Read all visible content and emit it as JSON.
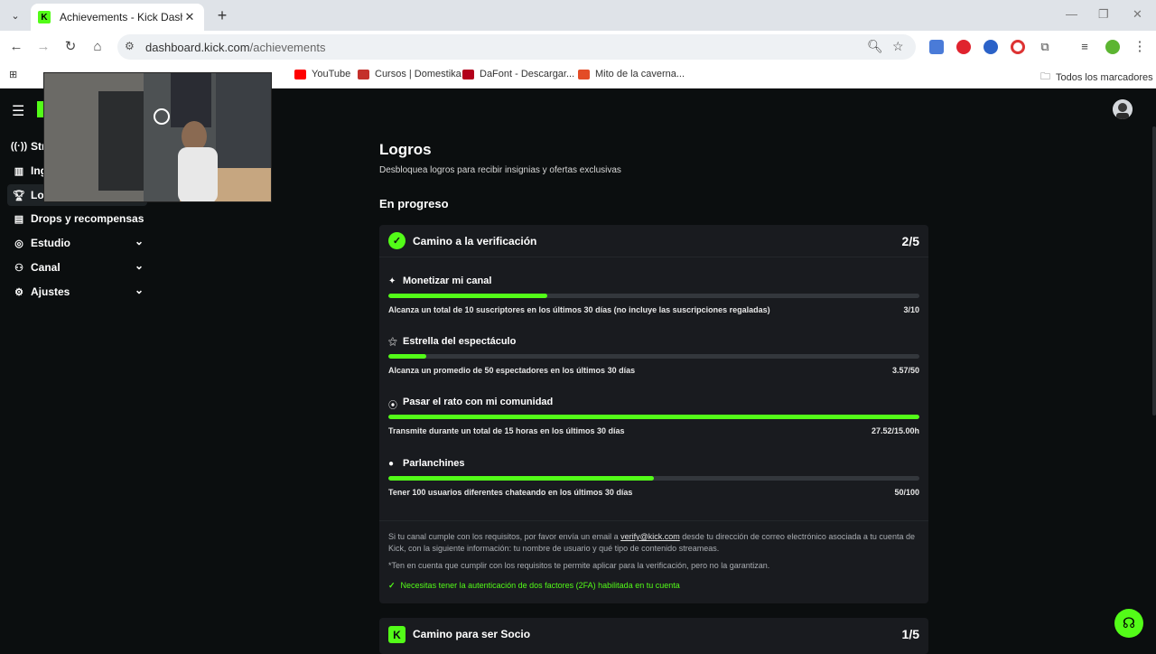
{
  "browser": {
    "tab_title": "Achievements - Kick Dashboard",
    "url_domain": "dashboard.kick.com",
    "url_path": "/achievements",
    "bookmarks": [
      {
        "label": "YouTube",
        "color": "#ff0000"
      },
      {
        "label": "Cursos | Domestika",
        "color": "#c4302b"
      },
      {
        "label": "DaFont - Descargar...",
        "color": "#b3001b"
      },
      {
        "label": "Mito de la caverna...",
        "color": "#e34c26"
      }
    ],
    "all_bookmarks": "Todos los marcadores"
  },
  "sidebar": {
    "items": [
      {
        "label": "Str",
        "icon": "broadcast-icon"
      },
      {
        "label": "Ing",
        "icon": "income-icon"
      },
      {
        "label": "Lo",
        "icon": "trophy-icon"
      },
      {
        "label": "Drops y recompensas",
        "icon": "gift-icon"
      },
      {
        "label": "Estudio",
        "icon": "studio-icon"
      },
      {
        "label": "Canal",
        "icon": "channel-icon"
      },
      {
        "label": "Ajustes",
        "icon": "gear-icon"
      }
    ]
  },
  "page": {
    "title": "Logros",
    "subtitle": "Desbloquea logros para recibir insignias y ofertas exclusivas",
    "section": "En progreso"
  },
  "card_verification": {
    "title": "Camino a la verificación",
    "count": "2/5",
    "achievements": [
      {
        "name": "Monetizar mi canal",
        "icon": "sparkle-icon",
        "desc": "Alcanza un total de 10 suscriptores en los últimos 30 días (no incluye las suscripciones regaladas)",
        "progress": "3/10",
        "fraction": 0.3
      },
      {
        "name": "Estrella del espectáculo",
        "icon": "star-users-icon",
        "desc": "Alcanza un promedio de 50 espectadores en los últimos 30 días",
        "progress": "3.57/50",
        "fraction": 0.0714
      },
      {
        "name": "Pasar el rato con mi comunidad",
        "icon": "broadcast-icon",
        "desc": "Transmite durante un total de 15 horas en los últimos 30 días",
        "progress": "27.52/15.00h",
        "fraction": 1.0
      },
      {
        "name": "Parlanchines",
        "icon": "chat-icon",
        "desc": "Tener 100 usuarios diferentes chateando en los últimos 30 días",
        "progress": "50/100",
        "fraction": 0.5
      }
    ],
    "note_part1": "Si tu canal cumple con los requisitos, por favor envía un email a ",
    "note_email": "verify@kick.com",
    "note_part2": " desde tu dirección de correo electrónico asociada a tu cuenta de Kick, con la siguiente información: tu nombre de usuario y qué tipo de contenido streameas.",
    "note_disclaimer": "*Ten en cuenta que cumplir con los requisitos te permite aplicar para la verificación, pero no la garantizan.",
    "tfa": "Necesitas tener la autenticación de dos factores (2FA) habilitada en tu cuenta"
  },
  "card_partner": {
    "title": "Camino para ser Socio",
    "count": "1/5"
  },
  "colors": {
    "accent": "#53fc18",
    "background": "#0b0e0f",
    "card": "#191b1f"
  }
}
